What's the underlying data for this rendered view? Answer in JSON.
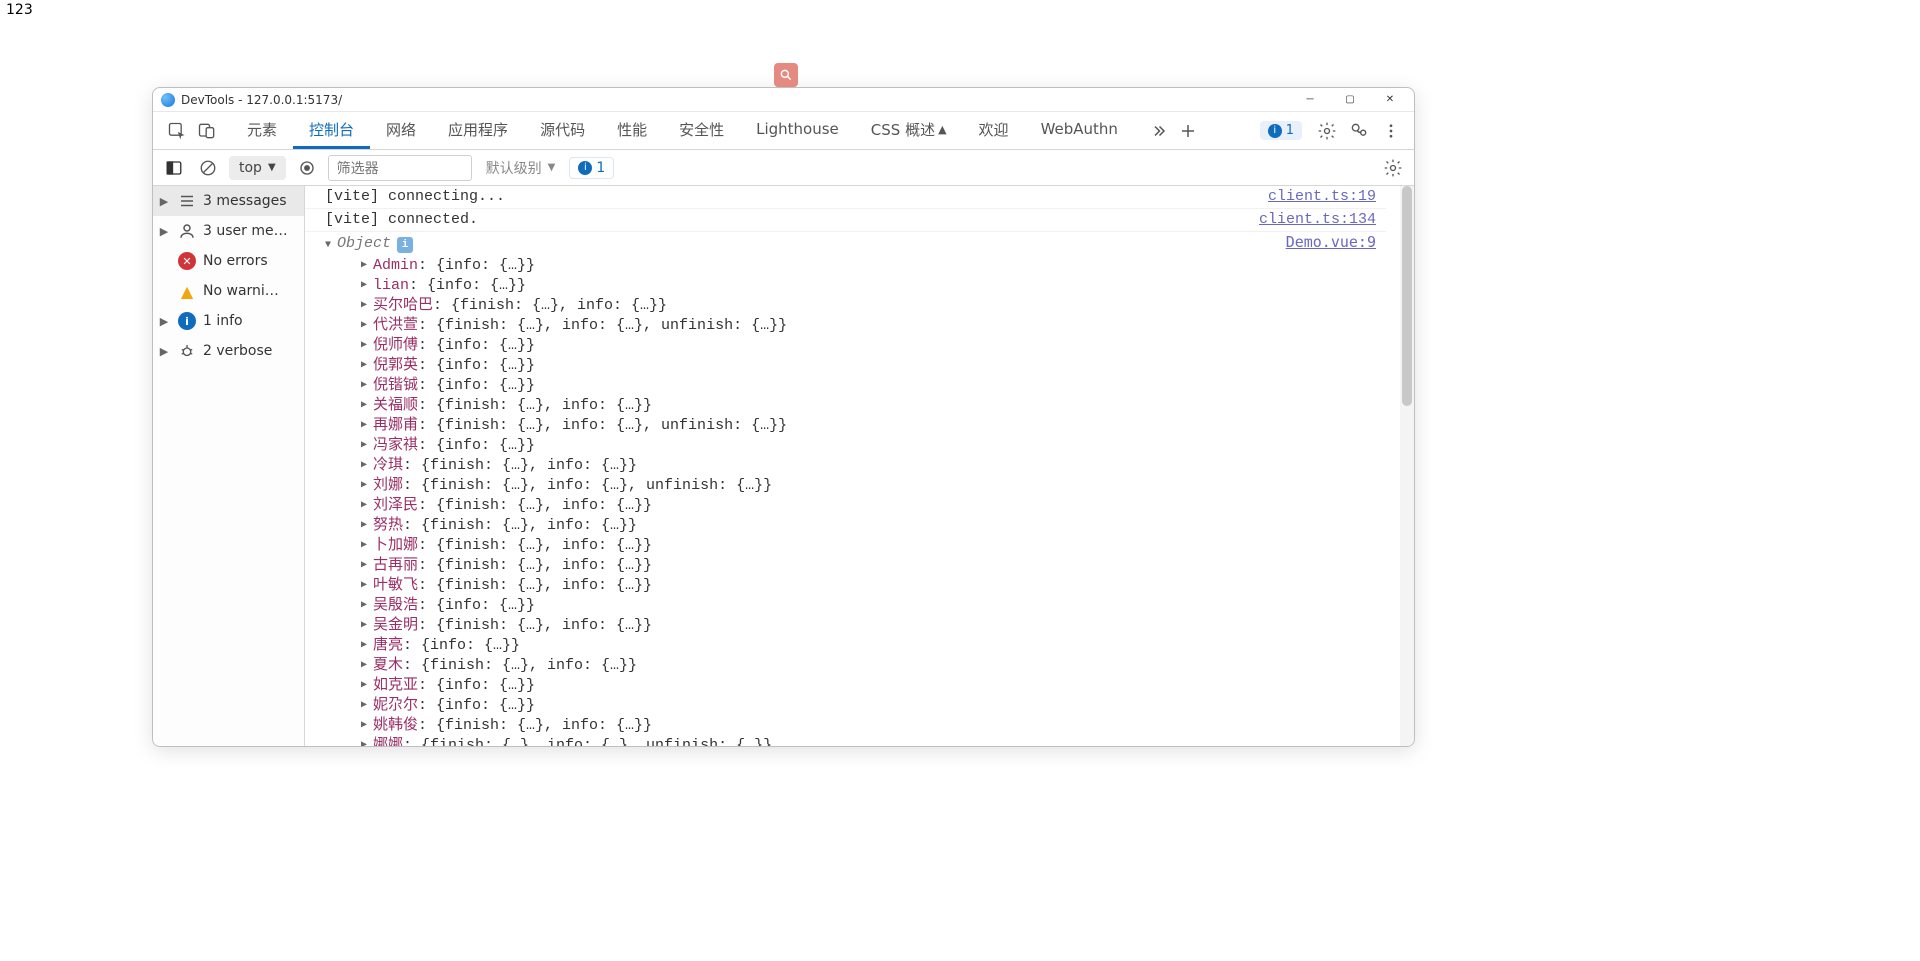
{
  "page_text_top": "123",
  "window": {
    "title": "DevTools - 127.0.0.1:5173/"
  },
  "top_tabs": [
    {
      "label": "元素"
    },
    {
      "label": "控制台",
      "active": true
    },
    {
      "label": "网络"
    },
    {
      "label": "应用程序"
    },
    {
      "label": "源代码"
    },
    {
      "label": "性能"
    },
    {
      "label": "安全性"
    },
    {
      "label": "Lighthouse"
    },
    {
      "label": "CSS 概述",
      "pin": "▲"
    },
    {
      "label": "欢迎"
    },
    {
      "label": "WebAuthn"
    }
  ],
  "top_badge": {
    "count": "1"
  },
  "filterbar": {
    "context": "top",
    "filter_placeholder": "筛选器",
    "level": "默认级别",
    "issue_count": "1"
  },
  "sidebar": [
    {
      "label": "3 messages",
      "icon": "list",
      "expandable": true,
      "selected": true
    },
    {
      "label": "3 user me…",
      "icon": "user",
      "expandable": true
    },
    {
      "label": "No errors",
      "icon": "error"
    },
    {
      "label": "No warni…",
      "icon": "warn"
    },
    {
      "label": "1 info",
      "icon": "info",
      "expandable": true
    },
    {
      "label": "2 verbose",
      "icon": "bug",
      "expandable": true
    }
  ],
  "logs": [
    {
      "msg": "[vite] connecting...",
      "src": "client.ts:19"
    },
    {
      "msg": "[vite] connected.",
      "src": "client.ts:134"
    }
  ],
  "object_log": {
    "label": "Object",
    "src": "Demo.vue:9",
    "props": [
      {
        "name": "Admin",
        "value": "{info: {…}}"
      },
      {
        "name": "lian",
        "value": "{info: {…}}"
      },
      {
        "name": "买尔哈巴",
        "value": "{finish: {…}, info: {…}}"
      },
      {
        "name": "代洪萱",
        "value": "{finish: {…}, info: {…}, unfinish: {…}}"
      },
      {
        "name": "倪师傅",
        "value": "{info: {…}}"
      },
      {
        "name": "倪郭英",
        "value": "{info: {…}}"
      },
      {
        "name": "倪锴铖",
        "value": "{info: {…}}"
      },
      {
        "name": "关福顺",
        "value": "{finish: {…}, info: {…}}"
      },
      {
        "name": "再娜甫",
        "value": "{finish: {…}, info: {…}, unfinish: {…}}"
      },
      {
        "name": "冯家祺",
        "value": "{info: {…}}"
      },
      {
        "name": "冷琪",
        "value": "{finish: {…}, info: {…}}"
      },
      {
        "name": "刘娜",
        "value": "{finish: {…}, info: {…}, unfinish: {…}}"
      },
      {
        "name": "刘泽民",
        "value": "{finish: {…}, info: {…}}"
      },
      {
        "name": "努热",
        "value": "{finish: {…}, info: {…}}"
      },
      {
        "name": "卜加娜",
        "value": "{finish: {…}, info: {…}}"
      },
      {
        "name": "古再丽",
        "value": "{finish: {…}, info: {…}}"
      },
      {
        "name": "叶敏飞",
        "value": "{finish: {…}, info: {…}}"
      },
      {
        "name": "吴殷浩",
        "value": "{info: {…}}"
      },
      {
        "name": "吴金明",
        "value": "{finish: {…}, info: {…}}"
      },
      {
        "name": "唐亮",
        "value": "{info: {…}}"
      },
      {
        "name": "夏木",
        "value": "{finish: {…}, info: {…}}"
      },
      {
        "name": "如克亚",
        "value": "{info: {…}}"
      },
      {
        "name": "妮尕尔",
        "value": "{info: {…}}"
      },
      {
        "name": "姚韩俊",
        "value": "{finish: {…}, info: {…}}"
      },
      {
        "name": "娜娜",
        "value": "{finish: {…}, info: {…}, unfinish: {…}}"
      }
    ]
  }
}
